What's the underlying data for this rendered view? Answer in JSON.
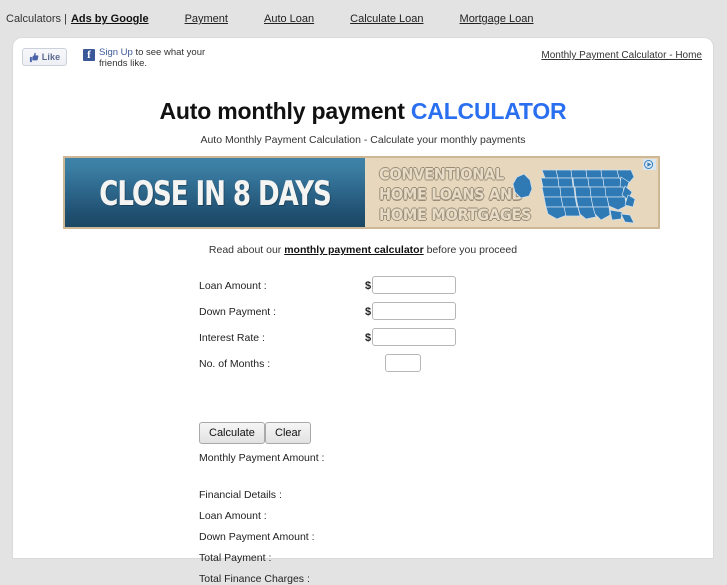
{
  "topbar": {
    "prefix": "Calculators |",
    "brand": "Ads by Google",
    "links": [
      {
        "label": "Payment"
      },
      {
        "label": "Auto Loan"
      },
      {
        "label": "Calculate Loan"
      },
      {
        "label": "Mortgage Loan"
      }
    ]
  },
  "social": {
    "like_label": "Like",
    "fb_glyph": "f",
    "signup_label": "Sign Up",
    "signup_rest": " to see what your friends like.",
    "home_link": "Monthly Payment Calculator - Home"
  },
  "heading": {
    "title_plain": "Auto monthly payment ",
    "title_accent": "CALCULATOR",
    "subtitle": "Auto Monthly Payment Calculation - Calculate your monthly payments",
    "accent_color": "#2a6ff0"
  },
  "banner": {
    "slogan": "CLOSE IN 8 DAYS",
    "copy_line1": "CONVENTIONAL",
    "copy_line2": "HOME LOANS AND",
    "copy_line3": "HOME MORTGAGES",
    "adchoices_label": "AdChoices",
    "left_bg": "#2f6a8f",
    "right_bg": "#e7d7bd",
    "border_color": "#cfb795"
  },
  "readabout": {
    "before": "Read about our ",
    "link": "monthly payment calculator",
    "after": " before you proceed"
  },
  "form": {
    "fields": [
      {
        "label": "Loan Amount :",
        "prefix": "$",
        "value": "",
        "placeholder": ""
      },
      {
        "label": "Down Payment :",
        "prefix": "$",
        "value": "",
        "placeholder": ""
      },
      {
        "label": "Interest Rate :",
        "prefix": "$",
        "value": "",
        "placeholder": ""
      },
      {
        "label": "No. of Months :",
        "prefix": "",
        "value": "",
        "placeholder": ""
      }
    ],
    "calculate_label": "Calculate",
    "clear_label": "Clear",
    "monthly_payment_label": "Monthly Payment Amount :"
  },
  "results": {
    "heading": "Financial Details :",
    "lines": [
      {
        "label": "Loan Amount :"
      },
      {
        "label": "Down Payment Amount :"
      },
      {
        "label": "Total Payment :"
      },
      {
        "label": "Total Finance Charges :"
      }
    ]
  }
}
